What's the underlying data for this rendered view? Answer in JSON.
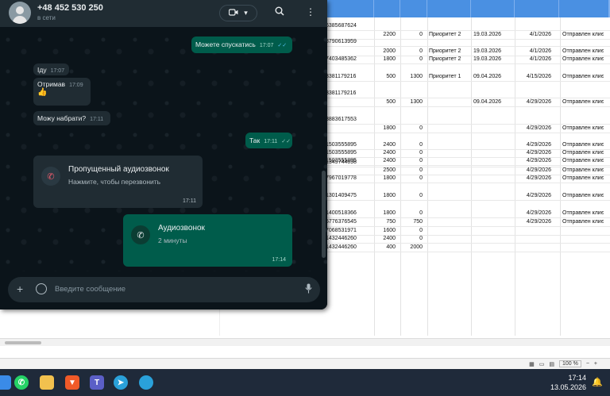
{
  "whatsapp": {
    "contact_name": "+48 452 530 250",
    "contact_status": "в сети",
    "messages": [
      {
        "dir": "out",
        "text": "Можете спускатись",
        "time": "17:07"
      },
      {
        "dir": "in",
        "text": "Іду",
        "time": "17:07"
      },
      {
        "dir": "in",
        "text": "Отримав",
        "time": "17:09"
      },
      {
        "dir": "in",
        "text": "👍",
        "time": ""
      },
      {
        "dir": "in",
        "text": "Можу набрати?",
        "time": "17:11"
      },
      {
        "dir": "out",
        "text": "Так",
        "time": "17:11"
      }
    ],
    "missed_call": {
      "title": "Пропущенный аудиозвонок",
      "subtitle": "Нажмите, чтобы перезвонить",
      "time": "17:11"
    },
    "audio_call": {
      "title": "Аудиозвонок",
      "subtitle": "2 минуты",
      "time": "17:14"
    },
    "input_placeholder": "Введите сообщение"
  },
  "sheet": {
    "rows": [
      {
        "phone": "6385687624",
        "a": "",
        "b": "",
        "prio": "",
        "date1": "",
        "date2": "",
        "status": ""
      },
      {
        "phone": "",
        "a": "2200",
        "b": "0",
        "prio": "Приоритет 2",
        "date1": "19.03.2026",
        "date2": "4/1/2026",
        "status": "Отправлен клиє"
      },
      {
        "phone": "8790613959",
        "a": "",
        "b": "",
        "prio": "",
        "date1": "",
        "date2": "",
        "status": ""
      },
      {
        "phone": "",
        "a": "2000",
        "b": "0",
        "prio": "Приоритет 2",
        "date1": "19.03.2026",
        "date2": "4/1/2026",
        "status": "Отправлен клиє"
      },
      {
        "phone": "7403485362",
        "a": "1800",
        "b": "0",
        "prio": "Приоритет 2",
        "date1": "19.03.2026",
        "date2": "4/1/2026",
        "status": "Отправлен клиє"
      },
      {
        "phone": "3381179216",
        "a": "500",
        "b": "1300",
        "prio": "Приоритет 1",
        "date1": "09.04.2026",
        "date2": "4/15/2026",
        "status": "Отправлен клиє"
      },
      {
        "phone": "3381179216",
        "a": "",
        "b": "",
        "prio": "",
        "date1": "",
        "date2": "",
        "status": ""
      },
      {
        "phone": "",
        "a": "500",
        "b": "1300",
        "prio": "",
        "date1": "09.04.2026",
        "date2": "4/29/2026",
        "status": "Отправлен клиє"
      },
      {
        "phone": "3883617553",
        "a": "",
        "b": "",
        "prio": "",
        "date1": "",
        "date2": "",
        "status": ""
      },
      {
        "phone": "",
        "a": "1800",
        "b": "0",
        "prio": "",
        "date1": "",
        "date2": "4/29/2026",
        "status": "Отправлен клиє"
      },
      {
        "phone": "1503555895",
        "a": "2400",
        "b": "0",
        "prio": "",
        "date1": "",
        "date2": "4/29/2026",
        "status": "Отправлен клиє"
      },
      {
        "phone": "1503555895",
        "a": "2400",
        "b": "0",
        "prio": "",
        "date1": "",
        "date2": "4/29/2026",
        "status": "Отправлен клиє"
      },
      {
        "phone": "1503555895",
        "a": "2400",
        "b": "0",
        "prio": "",
        "date1": "",
        "date2": "4/29/2026",
        "status": "Отправлен клиє"
      },
      {
        "phone": "1349744698",
        "a": "",
        "b": "",
        "prio": "",
        "date1": "",
        "date2": "",
        "status": ""
      },
      {
        "phone": "",
        "a": "2500",
        "b": "0",
        "prio": "",
        "date1": "",
        "date2": "4/29/2026",
        "status": "Отправлен клиє"
      },
      {
        "phone": "7967019778",
        "a": "1800",
        "b": "0",
        "prio": "",
        "date1": "",
        "date2": "4/29/2026",
        "status": "Отправлен клиє"
      },
      {
        "phone": "1301409475",
        "a": "1800",
        "b": "0",
        "prio": "",
        "date1": "",
        "date2": "4/29/2026",
        "status": "Отправлен клиє"
      },
      {
        "phone": "1400518366",
        "a": "1800",
        "b": "0",
        "prio": "",
        "date1": "",
        "date2": "4/29/2026",
        "status": "Отправлен клиє"
      },
      {
        "phone": "5776376545",
        "a": "750",
        "b": "750",
        "prio": "",
        "date1": "",
        "date2": "4/29/2026",
        "status": "Отправлен клиє"
      },
      {
        "phone": "7068531971",
        "a": "1600",
        "b": "0",
        "prio": "",
        "date1": "",
        "date2": "",
        "status": ""
      },
      {
        "phone": "1432446260",
        "a": "2400",
        "b": "0",
        "prio": "",
        "date1": "",
        "date2": "",
        "status": ""
      },
      {
        "phone": "1432446260",
        "a": "400",
        "b": "2000",
        "prio": "",
        "date1": "",
        "date2": "",
        "status": ""
      }
    ],
    "zoom": "100 %"
  },
  "taskbar": {
    "time": "17:14",
    "date": "13.05.2026"
  }
}
